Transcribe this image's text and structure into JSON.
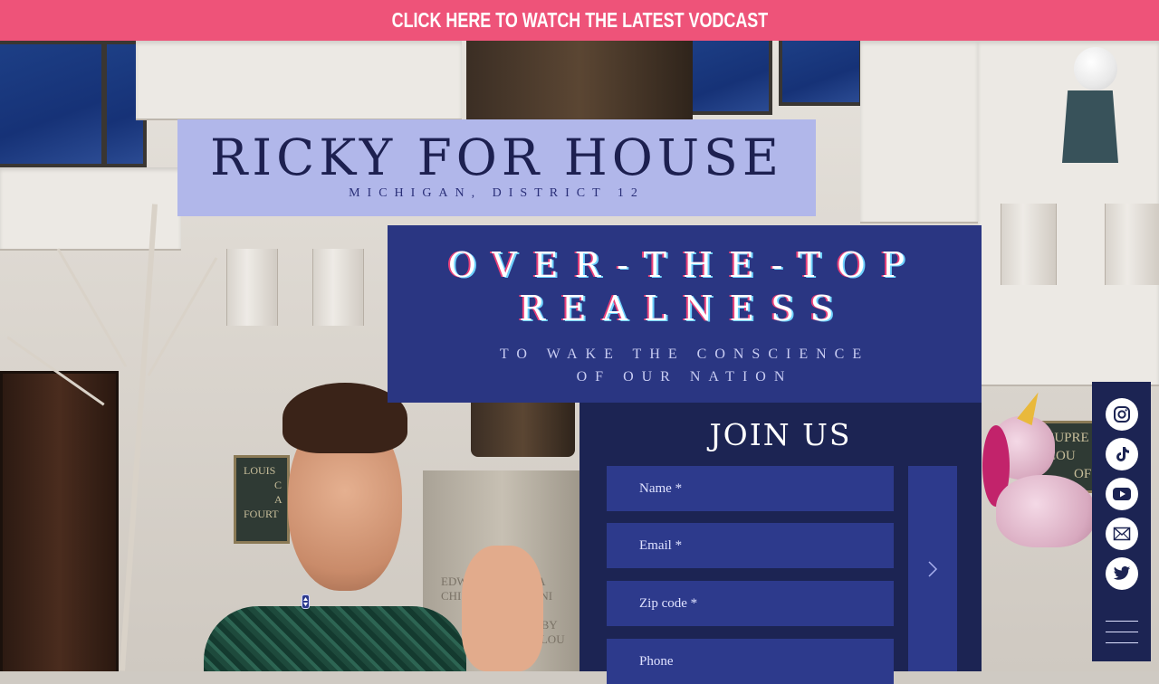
{
  "banner": {
    "text": "CLICK HERE TO WATCH THE LATEST VODCAST"
  },
  "title": {
    "name": "RICKY FOR HOUSE",
    "district": "MICHIGAN, DISTRICT 12"
  },
  "slogan": {
    "line1": "OVER-THE-TOP",
    "line2": "REALNESS",
    "sub1": "TO WAKE THE CONSCIENCE",
    "sub2": "OF OUR NATION"
  },
  "join": {
    "heading": "JOIN US",
    "fields": [
      {
        "placeholder": "Name *"
      },
      {
        "placeholder": "Email *"
      },
      {
        "placeholder": "Zip code *"
      },
      {
        "placeholder": "Phone"
      }
    ],
    "submit_icon": "chevron-right-icon"
  },
  "social": {
    "icons": [
      "instagram-icon",
      "tiktok-icon",
      "youtube-icon",
      "mail-icon",
      "twitter-icon"
    ],
    "menu_icon": "hamburger-menu-icon"
  },
  "background": {
    "plaque_left": [
      "LOUIS",
      "C",
      "A",
      "FOURT"
    ],
    "plaque_right": [
      "SUPRE",
      "COU",
      "OF"
    ],
    "pedestal_text": [
      "EDW",
      "OUGLA",
      "CHI",
      "UNI",
      "ED BY",
      "OF LOU"
    ]
  },
  "colors": {
    "banner": "#ee5379",
    "title_bg": "#b1b7ea",
    "slogan_bg": "#2a3682",
    "form_bg": "#1c2453",
    "field_bg": "#2d3a8c"
  }
}
